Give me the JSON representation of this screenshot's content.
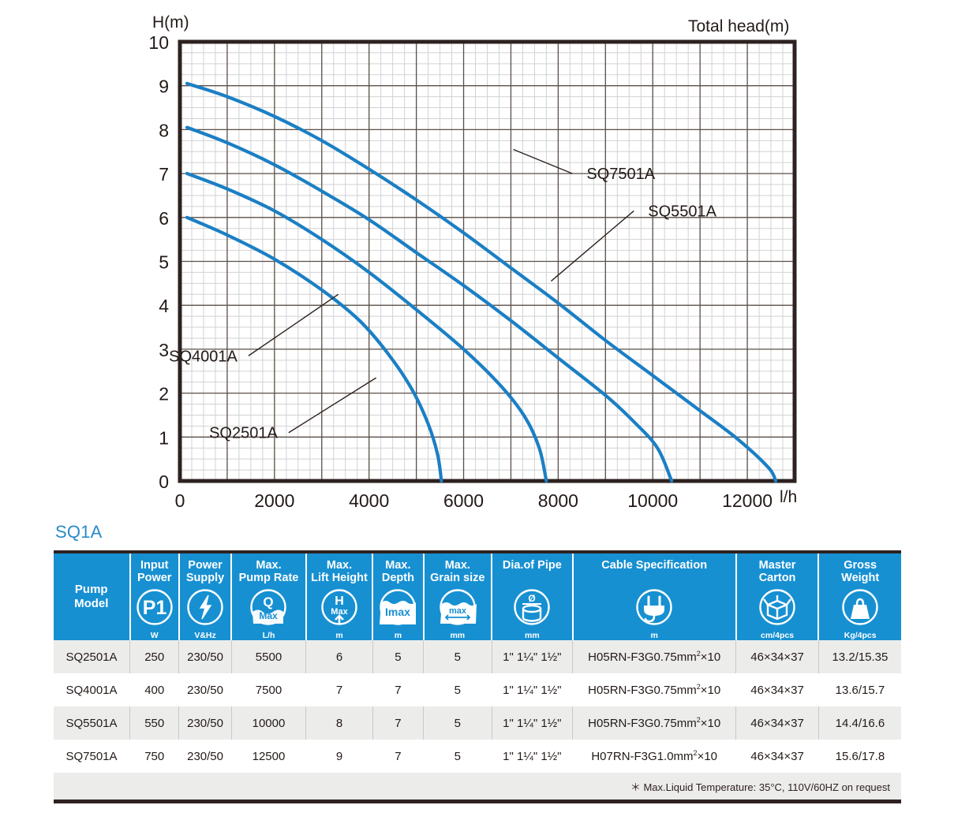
{
  "chart_data": {
    "type": "line",
    "title": "",
    "ylabel": "H(m)",
    "xlabel": "l/h",
    "corner_label": "Total head(m)",
    "xlim": [
      0,
      13000
    ],
    "ylim": [
      0,
      10
    ],
    "xticks": [
      0,
      2000,
      4000,
      6000,
      8000,
      10000,
      12000
    ],
    "xtick_labels": [
      "0",
      "2000",
      "4000",
      "6000",
      "8000",
      "10000",
      "12000"
    ],
    "yticks": [
      0,
      1,
      2,
      3,
      4,
      5,
      6,
      7,
      8,
      9,
      10
    ],
    "ytick_labels": [
      "0",
      "1",
      "2",
      "3",
      "4",
      "5",
      "6",
      "7",
      "8",
      "9",
      "10"
    ],
    "grid": true,
    "minor_grid": true,
    "minor_x_step": 250,
    "minor_y_step": 0.25,
    "legend_position": "inline-labels",
    "line_color": "#1b7fc4",
    "series": [
      {
        "name": "SQ7501A",
        "color": "#1b7fc4",
        "label_x": 8300,
        "label_y": 7.0,
        "points": [
          [
            150,
            9.05
          ],
          [
            1000,
            8.75
          ],
          [
            2000,
            8.3
          ],
          [
            3000,
            7.75
          ],
          [
            4000,
            7.1
          ],
          [
            5000,
            6.4
          ],
          [
            6000,
            5.65
          ],
          [
            7000,
            4.85
          ],
          [
            8000,
            4.05
          ],
          [
            9000,
            3.2
          ],
          [
            10000,
            2.4
          ],
          [
            11000,
            1.6
          ],
          [
            11800,
            0.95
          ],
          [
            12450,
            0.3
          ],
          [
            12600,
            0.0
          ]
        ]
      },
      {
        "name": "SQ5501A",
        "color": "#1b7fc4",
        "label_x": 9600,
        "label_y": 6.15,
        "points": [
          [
            150,
            8.05
          ],
          [
            1000,
            7.7
          ],
          [
            2000,
            7.2
          ],
          [
            3000,
            6.6
          ],
          [
            4000,
            5.95
          ],
          [
            5000,
            5.2
          ],
          [
            6000,
            4.45
          ],
          [
            7000,
            3.65
          ],
          [
            8000,
            2.8
          ],
          [
            9000,
            1.95
          ],
          [
            9600,
            1.35
          ],
          [
            10100,
            0.75
          ],
          [
            10400,
            0.0
          ]
        ]
      },
      {
        "name": "SQ4001A",
        "color": "#1b7fc4",
        "label_x": 1450,
        "label_y": 2.85,
        "points": [
          [
            150,
            7.0
          ],
          [
            1000,
            6.65
          ],
          [
            2000,
            6.15
          ],
          [
            3000,
            5.5
          ],
          [
            4000,
            4.75
          ],
          [
            5000,
            3.9
          ],
          [
            6000,
            3.0
          ],
          [
            6800,
            2.15
          ],
          [
            7300,
            1.45
          ],
          [
            7600,
            0.75
          ],
          [
            7750,
            0.0
          ]
        ]
      },
      {
        "name": "SQ2501A",
        "color": "#1b7fc4",
        "label_x": 2300,
        "label_y": 1.1,
        "points": [
          [
            150,
            6.0
          ],
          [
            1000,
            5.6
          ],
          [
            2000,
            5.05
          ],
          [
            3000,
            4.35
          ],
          [
            3800,
            3.65
          ],
          [
            4400,
            2.9
          ],
          [
            4900,
            2.1
          ],
          [
            5250,
            1.3
          ],
          [
            5450,
            0.6
          ],
          [
            5530,
            0.0
          ]
        ]
      }
    ]
  },
  "table": {
    "series_title": "SQ1A",
    "headers": [
      {
        "label": "Pump\nModel",
        "line1": "Pump",
        "line2": "Model",
        "icon": "none",
        "unit": ""
      },
      {
        "line1": "Input",
        "line2": "Power",
        "icon": "p1-power-icon",
        "unit": "W"
      },
      {
        "line1": "Power",
        "line2": "Supply",
        "icon": "lightning-bolt-icon",
        "unit": "V&Hz"
      },
      {
        "line1": "Max.",
        "line2": "Pump Rate",
        "icon": "q-max-flow-icon",
        "unit": "L/h"
      },
      {
        "line1": "Max.",
        "line2": "Lift Height",
        "icon": "h-max-lift-icon",
        "unit": "m"
      },
      {
        "line1": "Max.",
        "line2": "Depth",
        "icon": "imax-depth-icon",
        "unit": "m"
      },
      {
        "line1": "Max.",
        "line2": "Grain size",
        "icon": "max-grain-icon",
        "unit": "mm"
      },
      {
        "line1": "Dia.of Pipe",
        "line2": "",
        "icon": "pipe-diameter-icon",
        "unit": "mm"
      },
      {
        "line1": "Cable Specification",
        "line2": "",
        "icon": "power-plug-icon",
        "unit": "m"
      },
      {
        "line1": "Master",
        "line2": "Carton",
        "icon": "carton-box-icon",
        "unit": "cm/4pcs"
      },
      {
        "line1": "Gross",
        "line2": "Weight",
        "icon": "weight-icon",
        "unit": "Kg/4pcs"
      }
    ],
    "rows": [
      {
        "model": "SQ2501A",
        "input_power": "250",
        "power_supply": "230/50",
        "max_pump_rate": "5500",
        "max_lift_height": "6",
        "max_depth": "5",
        "max_grain_size": "5",
        "dia_of_pipe": "1\" 1¼\" 1½\"",
        "cable_spec_pre": "H05RN-F3G0.75mm",
        "cable_spec_sup": "2",
        "cable_spec_post": "×10",
        "master_carton": "46×34×37",
        "gross_weight": "13.2/15.35"
      },
      {
        "model": "SQ4001A",
        "input_power": "400",
        "power_supply": "230/50",
        "max_pump_rate": "7500",
        "max_lift_height": "7",
        "max_depth": "7",
        "max_grain_size": "5",
        "dia_of_pipe": "1\" 1¼\" 1½\"",
        "cable_spec_pre": "H05RN-F3G0.75mm",
        "cable_spec_sup": "2",
        "cable_spec_post": "×10",
        "master_carton": "46×34×37",
        "gross_weight": "13.6/15.7"
      },
      {
        "model": "SQ5501A",
        "input_power": "550",
        "power_supply": "230/50",
        "max_pump_rate": "10000",
        "max_lift_height": "8",
        "max_depth": "7",
        "max_grain_size": "5",
        "dia_of_pipe": "1\" 1¼\" 1½\"",
        "cable_spec_pre": "H05RN-F3G0.75mm",
        "cable_spec_sup": "2",
        "cable_spec_post": "×10",
        "master_carton": "46×34×37",
        "gross_weight": "14.4/16.6"
      },
      {
        "model": "SQ7501A",
        "input_power": "750",
        "power_supply": "230/50",
        "max_pump_rate": "12500",
        "max_lift_height": "9",
        "max_depth": "7",
        "max_grain_size": "5",
        "dia_of_pipe": "1\" 1¼\" 1½\"",
        "cable_spec_pre": "H07RN-F3G1.0mm",
        "cable_spec_sup": "2",
        "cable_spec_post": "×10",
        "master_carton": "46×34×37",
        "gross_weight": "15.6/17.8"
      }
    ],
    "footnote": "＊ Max.Liquid Temperature: 35°C, 110V/60HZ on request"
  },
  "colors": {
    "header_blue": "#1790d2",
    "title_blue": "#2a8ac9",
    "curve_blue": "#1b7fc4",
    "axis_dark": "#2e2220",
    "row_shade": "#ececeb"
  }
}
